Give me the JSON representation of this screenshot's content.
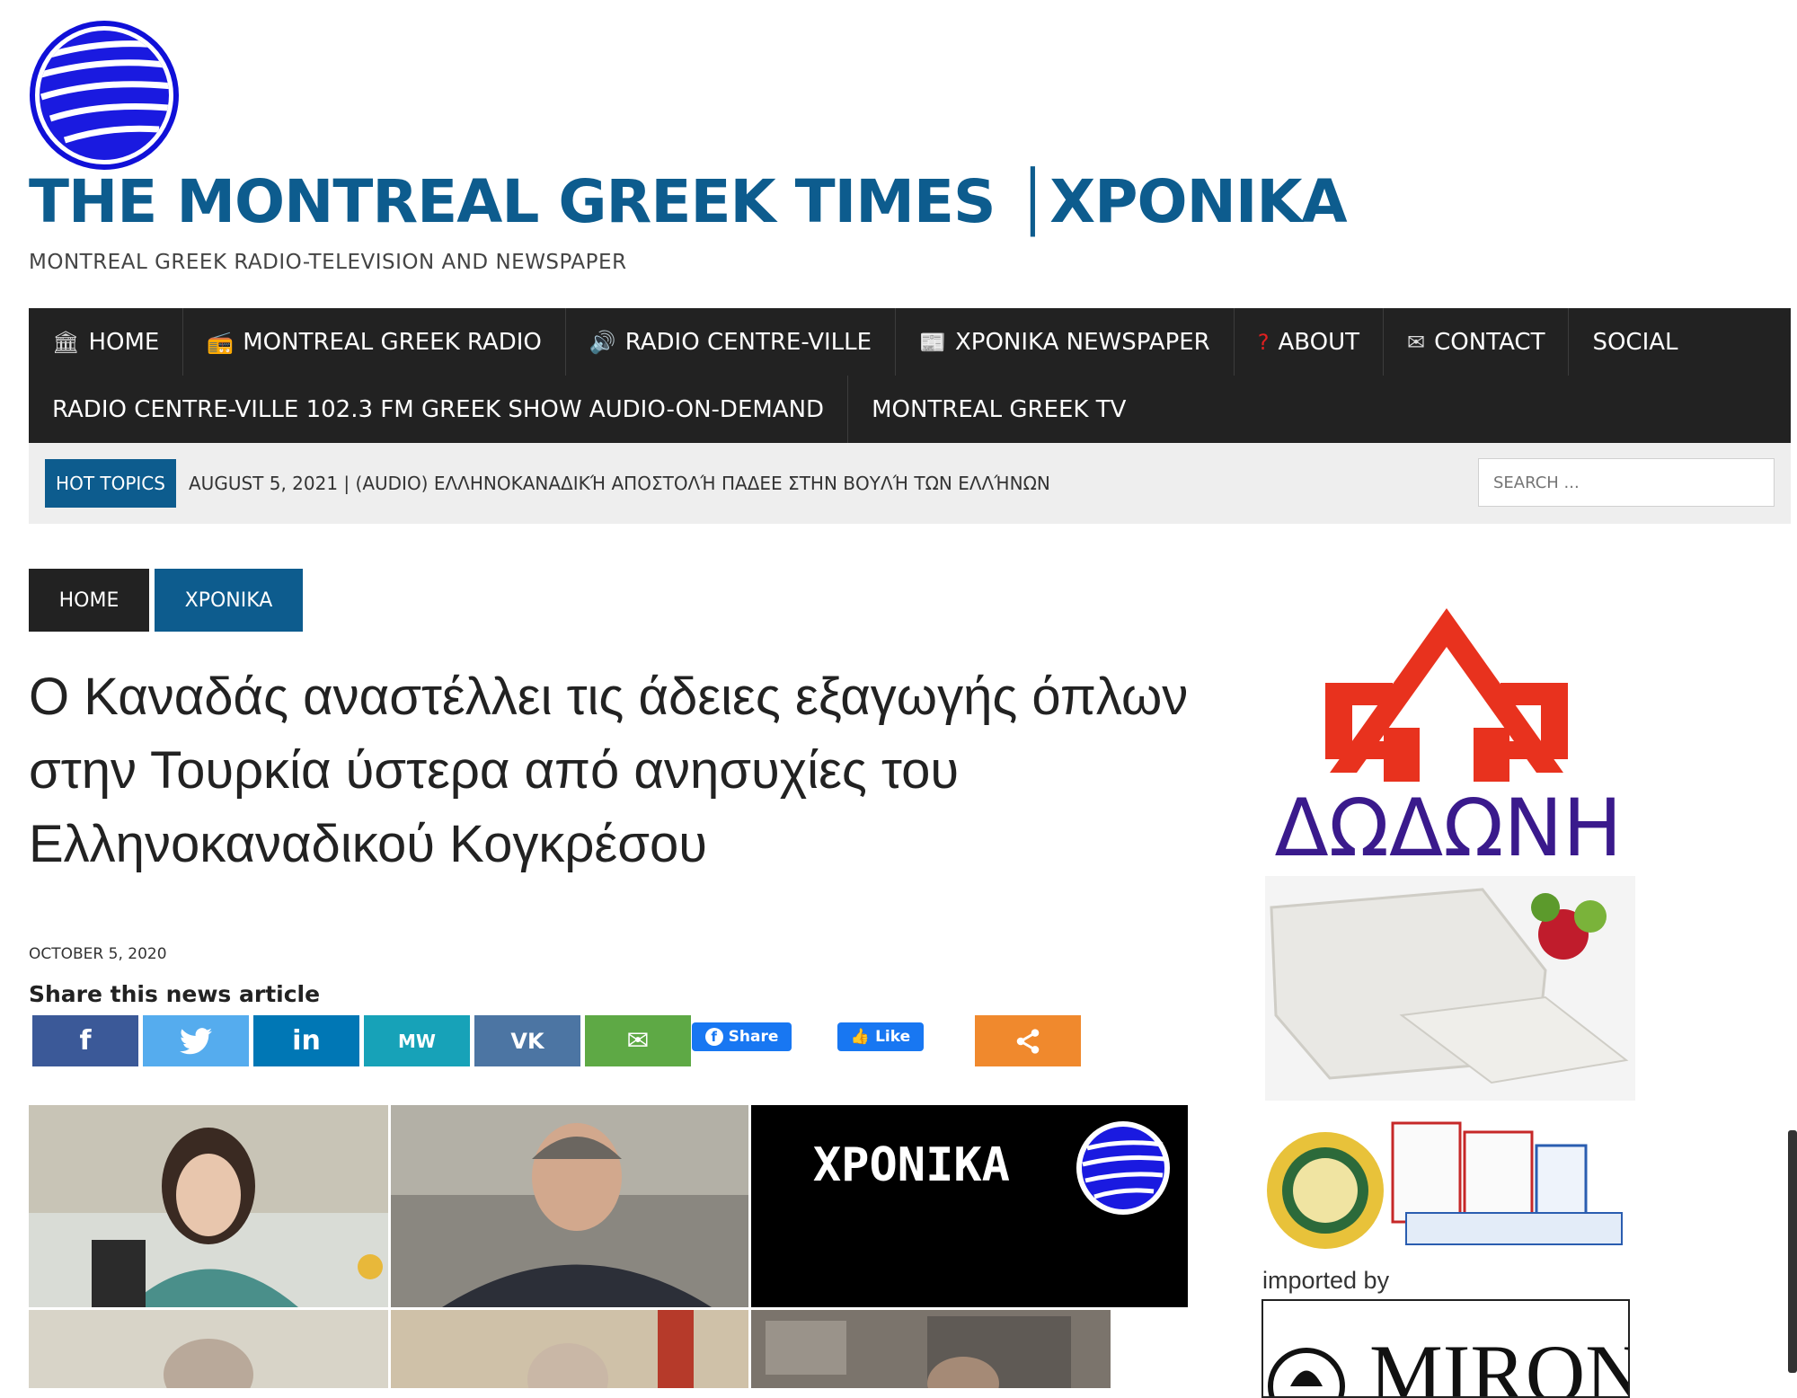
{
  "site": {
    "title": "THE MONTREAL GREEK TIMES │XPONIKA",
    "tagline": "MONTREAL GREEK RADIO-TELEVISION AND NEWSPAPER"
  },
  "nav": {
    "row1": [
      {
        "label": "HOME",
        "icon": "bank-icon"
      },
      {
        "label": "MONTREAL GREEK RADIO",
        "icon": "radio-icon"
      },
      {
        "label": "RADIO CENTRE-VILLE",
        "icon": "speaker-icon"
      },
      {
        "label": "XPONIKA NEWSPAPER",
        "icon": "newspaper-icon"
      },
      {
        "label": "ABOUT",
        "icon": "question-icon"
      },
      {
        "label": "CONTACT",
        "icon": "envelope-icon"
      },
      {
        "label": "SOCIAL",
        "icon": ""
      }
    ],
    "row2": [
      {
        "label": "RADIO CENTRE-VILLE 102.3 FM GREEK SHOW AUDIO-ON-DEMAND"
      },
      {
        "label": "MONTREAL GREEK TV"
      }
    ]
  },
  "hot_topics": {
    "badge": "HOT TOPICS",
    "text": "AUGUST 5, 2021  |  (AUDIO) ΕΛΛΗΝΟΚΑΝΑΔΙΚΉ ΑΠΟΣΤΟΛΉ ΠΑΔΕΕ ΣΤΗΝ ΒΟΥΛΉ ΤΩΝ ΕΛΛΉΝΩΝ"
  },
  "search": {
    "placeholder": "SEARCH ..."
  },
  "breadcrumb": {
    "home": "HOME",
    "category": "XPONIKA"
  },
  "article": {
    "title": "Ο Καναδάς αναστέλλει τις άδειες εξαγωγής όπλων στην Τουρκία ύστερα από ανησυχίες του Ελληνοκαναδικού Κογκρέσου",
    "date": "OCTOBER 5, 2020",
    "share_label": "Share this news article"
  },
  "share_buttons": [
    {
      "name": "facebook",
      "glyph": "f",
      "color": "#3b5998"
    },
    {
      "name": "twitter",
      "glyph": "🐦",
      "color": "#55acee"
    },
    {
      "name": "linkedin",
      "glyph": "in",
      "color": "#0077b5"
    },
    {
      "name": "mewe",
      "glyph": "MW",
      "color": "#17a2b8"
    },
    {
      "name": "vk",
      "glyph": "VK",
      "color": "#4c75a3"
    },
    {
      "name": "email",
      "glyph": "✉",
      "color": "#5ea945"
    },
    {
      "name": "more",
      "glyph": "<",
      "color": "#f0892d"
    }
  ],
  "fb_widgets": {
    "share": "Share",
    "like": "Like",
    "color": "#1877f2"
  },
  "photo": {
    "brand": "XPONIKA"
  },
  "sidebar_ad": {
    "brand": "ΔΩΔΩΝΗ",
    "imported_by": "imported by",
    "importer": "MIRON"
  },
  "colors": {
    "brand_blue": "#0d5c8e",
    "nav_bg": "#222222",
    "ad_red": "#e8321e",
    "ad_purple": "#3a1a8c"
  }
}
